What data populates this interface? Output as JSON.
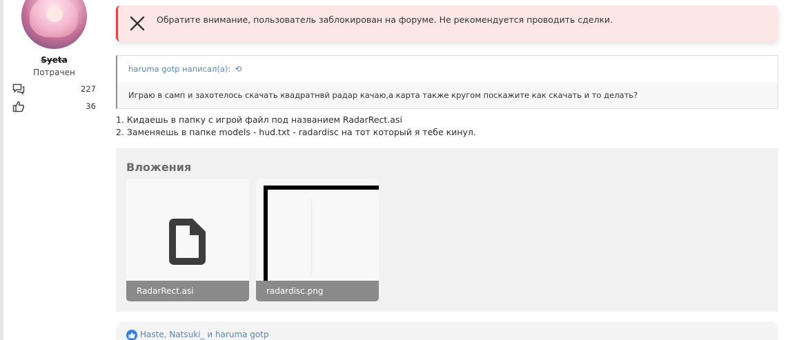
{
  "user": {
    "name": "Syeta",
    "title": "Потрачен",
    "messages_count": "227",
    "reactions_count": "36"
  },
  "icons": {
    "banner": "close-x-icon",
    "messages": "speech-bubbles-icon",
    "likes": "thumbs-up-icon",
    "quote_jump": "undo-arrow-icon",
    "attachment": "file-icon",
    "reaction": "like-reaction-icon"
  },
  "banner": {
    "text": "Обратите внимание, пользователь заблокирован на форуме. Не рекомендуется проводить сделки."
  },
  "quote": {
    "author": "haruma gotp написал(а):",
    "arrow": "⟲",
    "text": "Играю в самп и захотелось скачать квадратнвй радар качаю,а карта также кругом поскажите как скачать и то делать?"
  },
  "message": {
    "line1": "1. Кидаешь в папку с игрой файл под названием RadarRect.asi",
    "line2": "2. Заменяешь в папке models - hud.txt - radardisc на тот который я тебе кинул."
  },
  "attachments": {
    "title": "Вложения",
    "items": [
      {
        "filename": "RadarRect.asi",
        "kind": "file"
      },
      {
        "filename": "radardisc.png",
        "kind": "image"
      }
    ]
  },
  "reactions": {
    "text": "Haste, Natsuki_ и haruma gotp"
  },
  "colors": {
    "banner_bg": "#fde6e6",
    "banner_accent": "#d14a4a",
    "link": "#5b86b0",
    "like_blue": "#2b7de9"
  }
}
